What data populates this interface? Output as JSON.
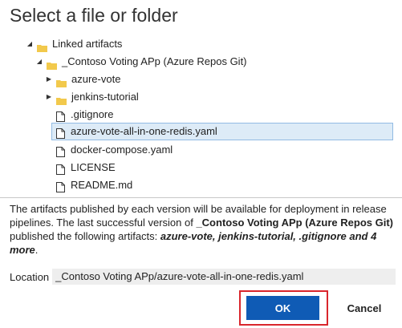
{
  "dialog": {
    "title": "Select a file or folder"
  },
  "tree": {
    "root": {
      "label": "Linked artifacts",
      "expanded": true,
      "icon": "folder-icon"
    },
    "repo": {
      "label": "_Contoso Voting APp (Azure Repos Git)",
      "expanded": true,
      "icon": "folder-icon"
    },
    "items": [
      {
        "label": "azure-vote",
        "type": "folder",
        "expanded": false,
        "icon": "folder-icon"
      },
      {
        "label": "jenkins-tutorial",
        "type": "folder",
        "expanded": false,
        "icon": "folder-icon"
      },
      {
        "label": ".gitignore",
        "type": "file",
        "icon": "file-icon"
      },
      {
        "label": "azure-vote-all-in-one-redis.yaml",
        "type": "file",
        "icon": "file-icon",
        "selected": true
      },
      {
        "label": "docker-compose.yaml",
        "type": "file",
        "icon": "file-icon"
      },
      {
        "label": "LICENSE",
        "type": "file",
        "icon": "file-icon"
      },
      {
        "label": "README.md",
        "type": "file",
        "icon": "file-icon"
      }
    ]
  },
  "info": {
    "text_1": "The artifacts published by each version will be available for deployment in release pipelines. The last successful version of ",
    "repo_name": "_Contoso Voting APp (Azure Repos Git)",
    "text_2": " published the following artifacts: ",
    "artifacts": "azure-vote, jenkins-tutorial, .gitignore and 4 more",
    "text_3": "."
  },
  "location": {
    "label": "Location",
    "value": "_Contoso Voting APp/azure-vote-all-in-one-redis.yaml"
  },
  "buttons": {
    "ok_label": "OK",
    "cancel_label": "Cancel"
  },
  "colors": {
    "folder": "#f2c94c",
    "selection_bg": "#ddebf7",
    "selection_border": "#92bbe3",
    "primary_button": "#0f5bb5",
    "highlight_box": "#d9262c"
  }
}
